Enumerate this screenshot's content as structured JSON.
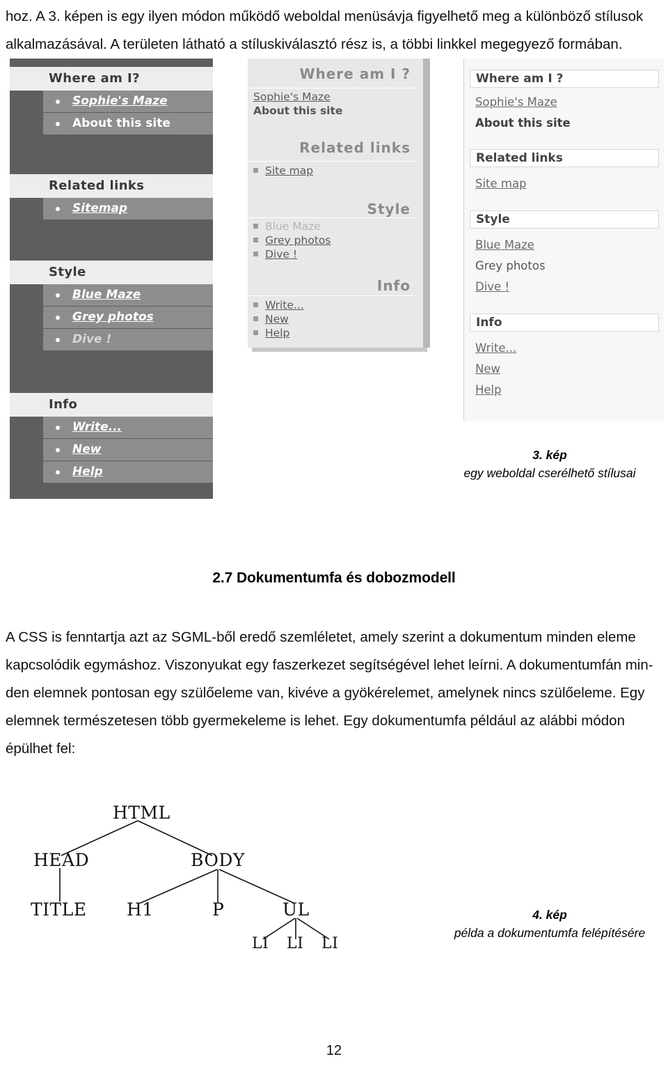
{
  "intro": {
    "line1": "hoz. A 3. képen is egy ilyen módon működő weboldal menüsávja figyelhető meg a különböző stílusok",
    "line2": "alkalmazásával. A területen látható a stíluskiválasztó rész is, a többi linkkel megegyező formában."
  },
  "figure3": {
    "panel_dark": {
      "name": "dark-theme-menu",
      "groups": [
        {
          "heading": "Where am I?",
          "items": [
            {
              "label": "Sophie's Maze",
              "state": "link"
            },
            {
              "label": "About this site",
              "state": "current"
            }
          ]
        },
        {
          "heading": "Related links",
          "items": [
            {
              "label": "Sitemap",
              "state": "link"
            }
          ]
        },
        {
          "heading": "Style",
          "items": [
            {
              "label": "Blue Maze",
              "state": "link"
            },
            {
              "label": "Grey photos",
              "state": "link"
            },
            {
              "label": "Dive !",
              "state": "disabled"
            }
          ]
        },
        {
          "heading": "Info",
          "items": [
            {
              "label": "Write...",
              "state": "link"
            },
            {
              "label": "New",
              "state": "link"
            },
            {
              "label": "Help",
              "state": "link"
            }
          ]
        }
      ]
    },
    "panel_grey": {
      "name": "grey-theme-menu",
      "groups": [
        {
          "heading": "Where am I ?",
          "items": [
            {
              "label": "Sophie's Maze",
              "state": "link",
              "marker": false
            },
            {
              "label": "About this site",
              "state": "current",
              "marker": false
            }
          ]
        },
        {
          "heading": "Related links",
          "items": [
            {
              "label": "Site map",
              "state": "link",
              "marker": true
            }
          ]
        },
        {
          "heading": "Style",
          "items": [
            {
              "label": "Blue Maze",
              "state": "disabled",
              "marker": true
            },
            {
              "label": "Grey photos",
              "state": "link",
              "marker": true
            },
            {
              "label": "Dive !",
              "state": "link",
              "marker": true
            }
          ]
        },
        {
          "heading": "Info",
          "items": [
            {
              "label": "Write...",
              "state": "link",
              "marker": true
            },
            {
              "label": "New",
              "state": "link",
              "marker": true
            },
            {
              "label": "Help",
              "state": "link",
              "marker": true
            }
          ]
        }
      ]
    },
    "panel_light": {
      "name": "light-theme-menu",
      "groups": [
        {
          "heading": "Where am I ?",
          "items": [
            {
              "label": "Sophie's Maze",
              "state": "link"
            },
            {
              "label": "About this site",
              "state": "current"
            }
          ]
        },
        {
          "heading": "Related links",
          "items": [
            {
              "label": "Site map",
              "state": "link"
            }
          ]
        },
        {
          "heading": "Style",
          "items": [
            {
              "label": "Blue Maze",
              "state": "link"
            },
            {
              "label": "Grey photos",
              "state": "plain"
            },
            {
              "label": "Dive !",
              "state": "link"
            }
          ]
        },
        {
          "heading": "Info",
          "items": [
            {
              "label": "Write...",
              "state": "link"
            },
            {
              "label": "New",
              "state": "link"
            },
            {
              "label": "Help",
              "state": "link"
            }
          ]
        }
      ]
    },
    "caption": {
      "number": "3. kép",
      "text": "egy weboldal cserélhető stílusai"
    }
  },
  "section": {
    "heading": "2.7 Dokumentumfa és dobozmodell",
    "body": {
      "line1": "A CSS is fenntartja azt az SGML-ből eredő szemléletet, amely szerint a dokumentum minden eleme",
      "line2": "kapcsolódik egymáshoz. Viszonyukat egy faszerkezet segítségével lehet leírni. A dokumentumfán min-",
      "line3": "den elemnek pontosan egy szülőeleme van, kivéve a gyökérelemet, amelynek nincs szülőeleme. Egy",
      "line4": "elemnek természetesen több gyermekeleme is lehet. Egy dokumentumfa például az alábbi módon",
      "line5": "épülhet fel:"
    }
  },
  "figure4": {
    "tree_nodes": {
      "html": "HTML",
      "head": "HEAD",
      "body": "BODY",
      "title": "TITLE",
      "h1": "H1",
      "p": "P",
      "ul": "UL",
      "li1": "LI",
      "li2": "LI",
      "li3": "LI"
    },
    "caption": {
      "number": "4. kép",
      "text": "példa a dokumentumfa felépítésére"
    }
  },
  "page_number": "12"
}
